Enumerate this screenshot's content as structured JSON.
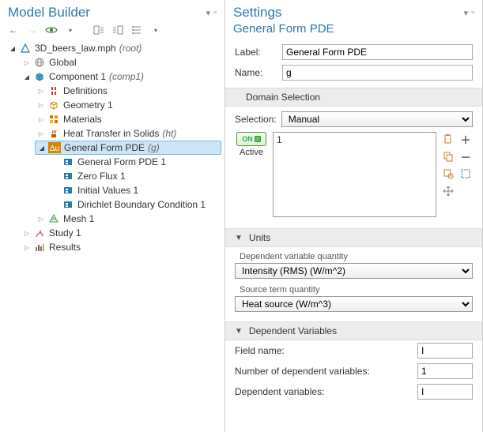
{
  "left": {
    "title": "Model Builder",
    "toolbar": {
      "back": "←",
      "fwd": "→",
      "up": "↑",
      "down": "↓"
    },
    "tree": {
      "root": {
        "label": "3D_beers_law.mph",
        "suffix": "(root)"
      },
      "global": "Global",
      "component": {
        "label": "Component 1",
        "suffix": "(comp1)"
      },
      "definitions": "Definitions",
      "geometry": "Geometry 1",
      "materials": "Materials",
      "heat": {
        "label": "Heat Transfer in Solids",
        "suffix": "(ht)"
      },
      "pde": {
        "label": "General Form PDE",
        "suffix": "(g)"
      },
      "pde1": "General Form PDE 1",
      "zeroflux": "Zero Flux 1",
      "initvals": "Initial Values 1",
      "dirichlet": "Dirichlet Boundary Condition 1",
      "mesh": "Mesh 1",
      "study": "Study 1",
      "results": "Results"
    }
  },
  "right": {
    "title": "Settings",
    "subtitle": "General Form PDE",
    "label_field": {
      "label": "Label:",
      "value": "General Form PDE"
    },
    "name_field": {
      "label": "Name:",
      "value": "g"
    },
    "domain_sel": {
      "header": "Domain Selection",
      "selection_label": "Selection:",
      "selection_value": "Manual",
      "active_label": "Active",
      "on_text": "ON",
      "items": [
        "1"
      ]
    },
    "units": {
      "header": "Units",
      "dep_var_q_legend": "Dependent variable quantity",
      "dep_var_q_value": "Intensity (RMS) (W/m^2)",
      "source_q_legend": "Source term quantity",
      "source_q_value": "Heat source (W/m^3)"
    },
    "dep_vars": {
      "header": "Dependent Variables",
      "field_name_label": "Field name:",
      "field_name_value": "I",
      "n_label": "Number of dependent variables:",
      "n_value": "1",
      "vars_label": "Dependent variables:",
      "vars_value": "I"
    }
  }
}
